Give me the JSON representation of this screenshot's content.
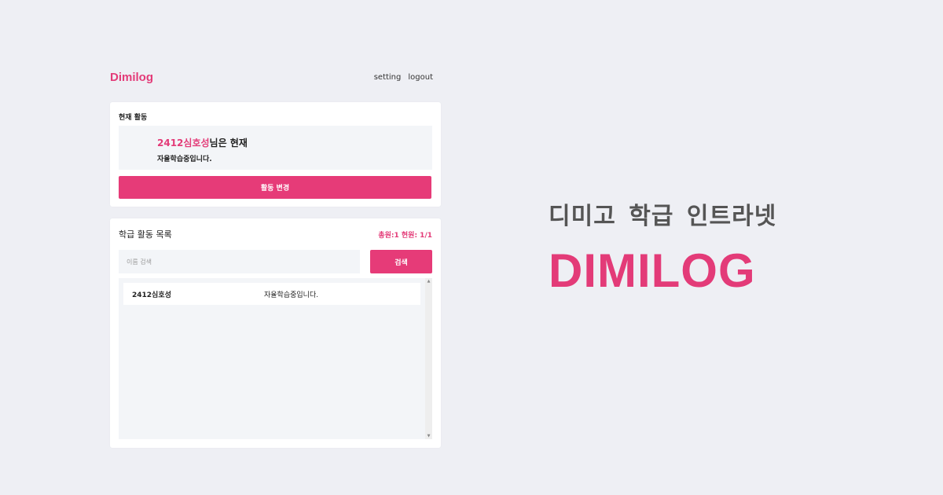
{
  "header": {
    "brand": "Dimilog",
    "nav": {
      "setting": "setting",
      "logout": "logout"
    }
  },
  "current_activity": {
    "title": "현재 활동",
    "user_name": "2412심호성",
    "line1_suffix": "님은 현재",
    "line2": "자율학습중입니다.",
    "change_button": "활동 변경"
  },
  "class_list": {
    "title": "학급 활동 목록",
    "counts": "총원:1 현원: 1/1",
    "search_placeholder": "이름 검색",
    "search_button": "검색",
    "rows": [
      {
        "name": "2412심호성",
        "activity": "자율학습중입니다."
      }
    ]
  },
  "hero": {
    "tagline": "디미고 학급 인트라넷",
    "title": "DIMILOG"
  },
  "colors": {
    "accent": "#e63b78",
    "background": "#eeeff4"
  },
  "icons": {
    "scroll_up": "scroll-up-arrow-icon",
    "scroll_down": "scroll-down-arrow-icon"
  }
}
